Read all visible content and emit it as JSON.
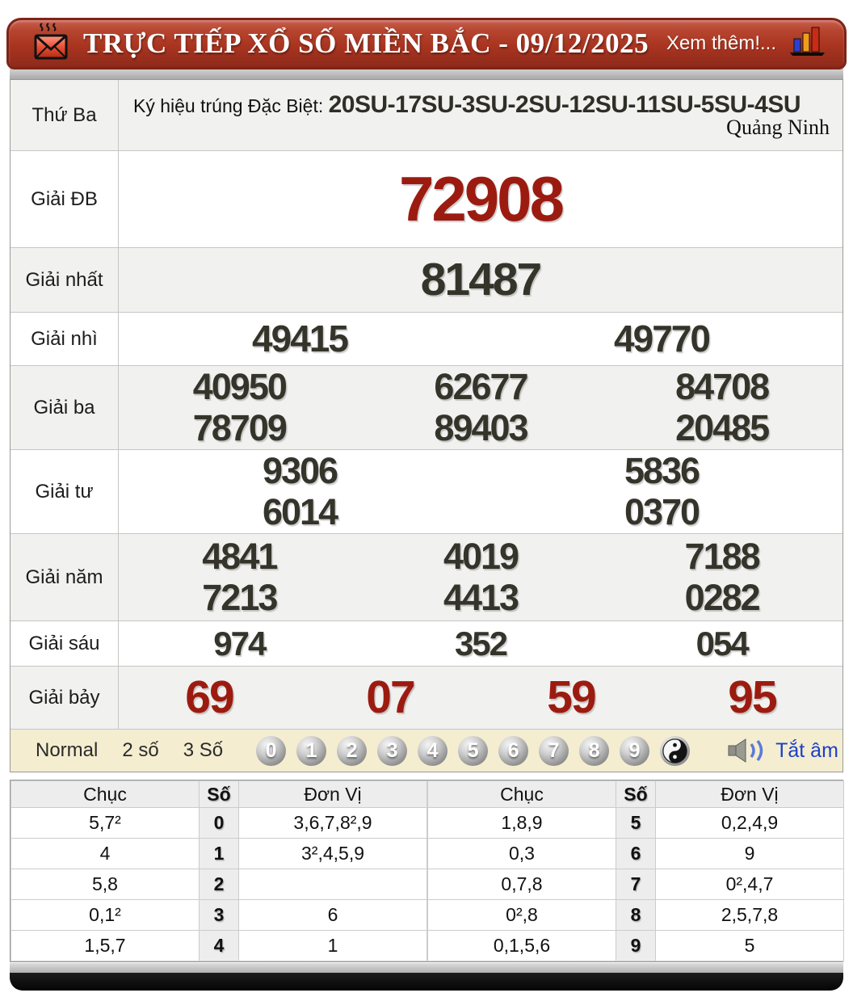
{
  "header": {
    "title": "TRỰC TIẾP XỔ SỐ MIỀN BẮC - 09/12/2025",
    "more_label": "Xem thêm!..."
  },
  "info": {
    "day": "Thứ Ba",
    "sign_label": "Ký hiệu trúng Đặc Biệt: ",
    "sign_codes": "20SU-17SU-3SU-2SU-12SU-11SU-5SU-4SU",
    "province": "Quảng Ninh"
  },
  "prizes": {
    "rows": [
      {
        "label": "Giải ĐB",
        "numbers": [
          "72908"
        ]
      },
      {
        "label": "Giải nhất",
        "numbers": [
          "81487"
        ]
      },
      {
        "label": "Giải nhì",
        "numbers": [
          "49415",
          "49770"
        ]
      },
      {
        "label": "Giải ba",
        "numbers": [
          "40950",
          "62677",
          "84708",
          "78709",
          "89403",
          "20485"
        ]
      },
      {
        "label": "Giải tư",
        "numbers": [
          "9306",
          "5836",
          "6014",
          "0370"
        ]
      },
      {
        "label": "Giải năm",
        "numbers": [
          "4841",
          "4019",
          "7188",
          "7213",
          "4413",
          "0282"
        ]
      },
      {
        "label": "Giải sáu",
        "numbers": [
          "974",
          "352",
          "054"
        ]
      },
      {
        "label": "Giải bảy",
        "numbers": [
          "69",
          "07",
          "59",
          "95"
        ]
      }
    ]
  },
  "controls": {
    "modes": [
      "Normal",
      "2 số",
      "3 Số"
    ],
    "balls": [
      "0",
      "1",
      "2",
      "3",
      "4",
      "5",
      "6",
      "7",
      "8",
      "9"
    ],
    "mute_label": "Tắt âm"
  },
  "stats": {
    "headers": [
      "Chục",
      "Số",
      "Đơn Vị"
    ],
    "left": [
      [
        "5,7²",
        "0",
        "3,6,7,8²,9"
      ],
      [
        "4",
        "1",
        "3²,4,5,9"
      ],
      [
        "5,8",
        "2",
        ""
      ],
      [
        "0,1²",
        "3",
        "6"
      ],
      [
        "1,5,7",
        "4",
        "1"
      ]
    ],
    "right": [
      [
        "1,8,9",
        "5",
        "0,2,4,9"
      ],
      [
        "0,3",
        "6",
        "9"
      ],
      [
        "0,7,8",
        "7",
        "0²,4,7"
      ],
      [
        "0²,8",
        "8",
        "2,5,7,8"
      ],
      [
        "0,1,5,6",
        "9",
        "5"
      ]
    ]
  },
  "colors": {
    "header_red": "#a93420",
    "prize_red": "#9c1b10",
    "link_blue": "#1d3fc8",
    "control_bar_cream": "#f4edd0"
  }
}
